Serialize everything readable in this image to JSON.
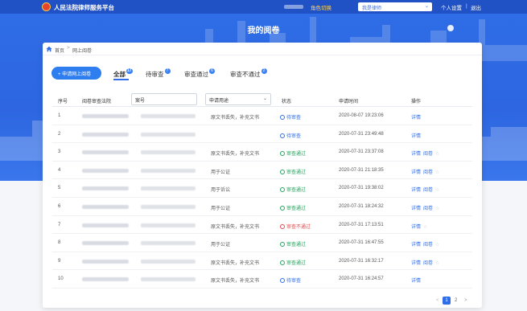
{
  "topbar": {
    "app_title": "人民法院律师服务平台",
    "role_label": "角色切换",
    "role_value": "我是律师",
    "user_settings": "个人设置",
    "separator": "|",
    "logout": "退出"
  },
  "header": {
    "page_title": "我的阅卷"
  },
  "breadcrumb": {
    "home": "首页",
    "separator": ">",
    "current": "网上阅卷"
  },
  "toolbar": {
    "apply_button": "+ 申请网上阅卷"
  },
  "tabs": [
    {
      "label": "全部",
      "count": "17"
    },
    {
      "label": "待审查",
      "count": "7"
    },
    {
      "label": "审查通过",
      "count": "6"
    },
    {
      "label": "审查不通过",
      "count": "2"
    }
  ],
  "table": {
    "headers": {
      "index": "序号",
      "court": "阅卷审查法院",
      "case_placeholder": "案号",
      "usage_filter": "申请用途",
      "status": "状态",
      "time": "申请时间",
      "action": "操作"
    },
    "rows": [
      {
        "index": "1",
        "usage": "原文书丢失，补充文书",
        "status": "待审查",
        "status_type": "pending",
        "time": "2020-08-07 19:23:06",
        "actions": [
          "详情"
        ],
        "starred": false
      },
      {
        "index": "2",
        "usage": "",
        "status": "待审查",
        "status_type": "pending",
        "time": "2020-07-31 23:49:48",
        "actions": [
          "详情"
        ],
        "starred": false
      },
      {
        "index": "3",
        "usage": "原文书丢失，补充文书",
        "status": "审查通过",
        "status_type": "passed",
        "time": "2020-07-31 23:37:08",
        "actions": [
          "详情",
          "阅卷"
        ],
        "starred": true
      },
      {
        "index": "4",
        "usage": "用于公证",
        "status": "审查通过",
        "status_type": "passed",
        "time": "2020-07-31 21:18:35",
        "actions": [
          "详情",
          "阅卷"
        ],
        "starred": true
      },
      {
        "index": "5",
        "usage": "用于诉讼",
        "status": "审查通过",
        "status_type": "passed",
        "time": "2020-07-31 19:38:02",
        "actions": [
          "详情",
          "阅卷"
        ],
        "starred": true
      },
      {
        "index": "6",
        "usage": "用于公证",
        "status": "审查通过",
        "status_type": "passed",
        "time": "2020-07-31 18:24:32",
        "actions": [
          "详情",
          "阅卷"
        ],
        "starred": true
      },
      {
        "index": "7",
        "usage": "原文书丢失，补充文书",
        "status": "审查不通过",
        "status_type": "failed",
        "time": "2020-07-31 17:13:51",
        "actions": [
          "详情"
        ],
        "starred": true
      },
      {
        "index": "8",
        "usage": "用于公证",
        "status": "审查通过",
        "status_type": "passed",
        "time": "2020-07-31 16:47:55",
        "actions": [
          "详情",
          "阅卷"
        ],
        "starred": true
      },
      {
        "index": "9",
        "usage": "原文书丢失，补充文书",
        "status": "审查通过",
        "status_type": "passed",
        "time": "2020-07-31 16:32:17",
        "actions": [
          "详情",
          "阅卷"
        ],
        "starred": true
      },
      {
        "index": "10",
        "usage": "原文书丢失，补充文书",
        "status": "待审查",
        "status_type": "pending",
        "time": "2020-07-31 16:24:57",
        "actions": [
          "详情"
        ],
        "starred": false
      }
    ]
  },
  "pagination": {
    "prev": "<",
    "pages": [
      "1",
      "2"
    ],
    "current": "1",
    "next": ">"
  },
  "colors": {
    "primary": "#2f6ee8",
    "passed": "#22a45d",
    "failed": "#e5484d",
    "hero": "#2f6ee8"
  },
  "icons": {
    "home": "home-icon",
    "pending": "clock-icon",
    "passed": "check-circle-icon",
    "failed": "x-circle-icon",
    "star": "star-icon",
    "chevron": "chevron-down-icon"
  }
}
